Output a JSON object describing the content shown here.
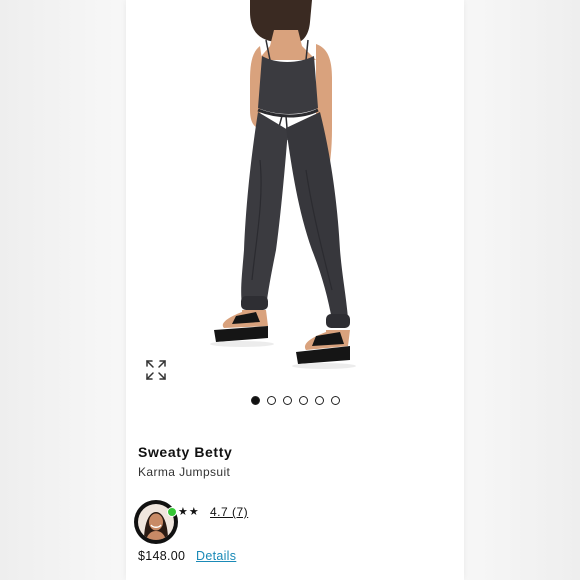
{
  "product": {
    "brand": "Sweaty Betty",
    "name": "Karma Jumpsuit",
    "price": "$148.00",
    "details_label": "Details"
  },
  "rating": {
    "stars": "★★",
    "label": "4.7 (7)"
  },
  "carousel": {
    "total": 6,
    "active_index": 0
  },
  "icons": {
    "expand": "expand-arrows-icon",
    "online": "online-status-dot"
  },
  "colors": {
    "link": "#1a8ab7",
    "online": "#35c635",
    "garment": "#3b3b40"
  }
}
